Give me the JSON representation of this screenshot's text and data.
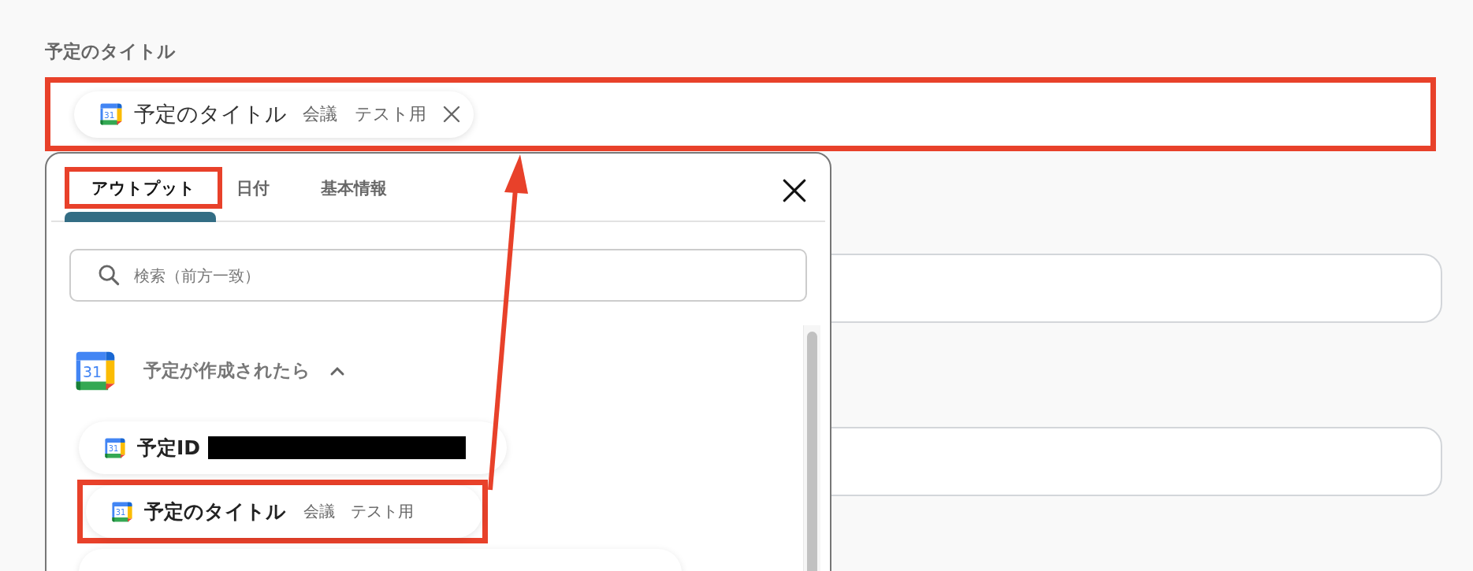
{
  "field": {
    "label": "予定のタイトル",
    "highlighted": true,
    "chip": {
      "icon_label": "31",
      "name": "予定のタイトル",
      "value": "会議　テスト用"
    }
  },
  "other_fields": [
    {
      "kind": "text"
    },
    {
      "kind": "text"
    }
  ],
  "dropdown": {
    "tabs": [
      {
        "label": "アウトプット",
        "selected": true,
        "highlighted": true
      },
      {
        "label": "日付",
        "selected": false,
        "highlighted": false
      },
      {
        "label": "基本情報",
        "selected": false,
        "highlighted": false
      }
    ],
    "search": {
      "placeholder": "検索（前方一致）"
    },
    "group": {
      "icon_label": "31",
      "title": "予定が作成されたら",
      "expanded": true
    },
    "items": [
      {
        "icon_label": "31",
        "name": "予定ID",
        "redacted": true,
        "highlighted": false
      },
      {
        "icon_label": "31",
        "name": "予定のタイトル",
        "value": "会議　テスト用",
        "redacted": false,
        "highlighted": true
      },
      {
        "kind": "partial"
      }
    ]
  },
  "arrow": true
}
